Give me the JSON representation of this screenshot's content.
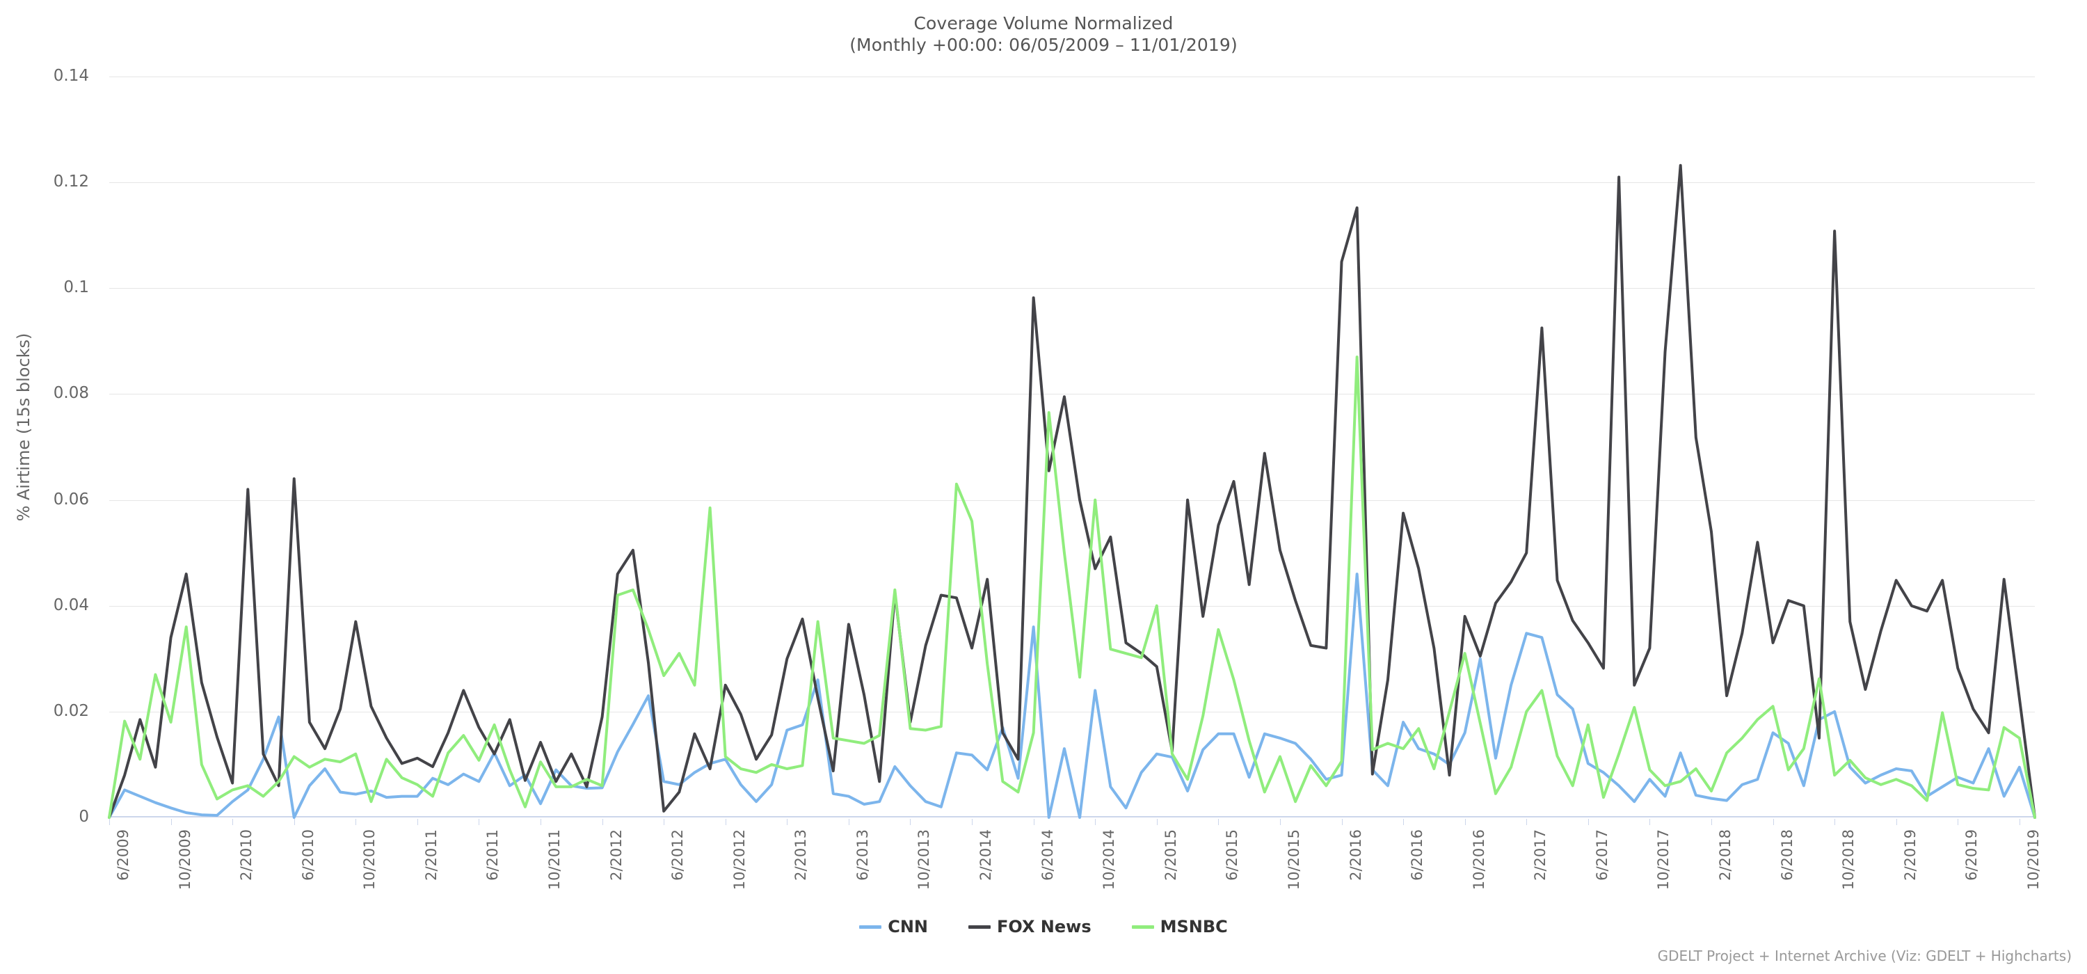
{
  "chart_data": {
    "type": "line",
    "title": "Coverage Volume Normalized",
    "subtitle": "(Monthly +00:00: 06/05/2009 – 11/01/2019)",
    "xlabel": "",
    "ylabel": "% Airtime (15s blocks)",
    "ylim": [
      0,
      0.14
    ],
    "y_ticks": [
      "0",
      "0.02",
      "0.04",
      "0.06",
      "0.08",
      "0.1",
      "0.12",
      "0.14"
    ],
    "y_tick_values": [
      0,
      0.02,
      0.04,
      0.06,
      0.08,
      0.1,
      0.12,
      0.14
    ],
    "grid": true,
    "legend_position": "bottom",
    "credit": "GDELT Project + Internet Archive (Viz: GDELT + Highcharts)",
    "x_tick_labels": [
      "6/2009",
      "10/2009",
      "2/2010",
      "6/2010",
      "10/2010",
      "2/2011",
      "6/2011",
      "10/2011",
      "2/2012",
      "6/2012",
      "10/2012",
      "2/2013",
      "6/2013",
      "10/2013",
      "2/2014",
      "6/2014",
      "10/2014",
      "2/2015",
      "6/2015",
      "10/2015",
      "2/2016",
      "6/2016",
      "10/2016",
      "2/2017",
      "6/2017",
      "10/2017",
      "2/2018",
      "6/2018",
      "10/2018",
      "2/2019",
      "6/2019",
      "10/2019"
    ],
    "x_tick_interval_months": 4,
    "x_start": "6/2009",
    "x_end": "11/2019",
    "categories": [
      "6/2009",
      "7/2009",
      "8/2009",
      "9/2009",
      "10/2009",
      "11/2009",
      "12/2009",
      "1/2010",
      "2/2010",
      "3/2010",
      "4/2010",
      "5/2010",
      "6/2010",
      "7/2010",
      "8/2010",
      "9/2010",
      "10/2010",
      "11/2010",
      "12/2010",
      "1/2011",
      "2/2011",
      "3/2011",
      "4/2011",
      "5/2011",
      "6/2011",
      "7/2011",
      "8/2011",
      "9/2011",
      "10/2011",
      "11/2011",
      "12/2011",
      "1/2012",
      "2/2012",
      "3/2012",
      "4/2012",
      "5/2012",
      "6/2012",
      "7/2012",
      "8/2012",
      "9/2012",
      "10/2012",
      "11/2012",
      "12/2012",
      "1/2013",
      "2/2013",
      "3/2013",
      "4/2013",
      "5/2013",
      "6/2013",
      "7/2013",
      "8/2013",
      "9/2013",
      "10/2013",
      "11/2013",
      "12/2013",
      "1/2014",
      "2/2014",
      "3/2014",
      "4/2014",
      "5/2014",
      "6/2014",
      "7/2014",
      "8/2014",
      "9/2014",
      "10/2014",
      "11/2014",
      "12/2014",
      "1/2015",
      "2/2015",
      "3/2015",
      "4/2015",
      "5/2015",
      "6/2015",
      "7/2015",
      "8/2015",
      "9/2015",
      "10/2015",
      "11/2015",
      "12/2015",
      "1/2016",
      "2/2016",
      "3/2016",
      "4/2016",
      "5/2016",
      "6/2016",
      "7/2016",
      "8/2016",
      "9/2016",
      "10/2016",
      "11/2016",
      "12/2016",
      "1/2017",
      "2/2017",
      "3/2017",
      "4/2017",
      "5/2017",
      "6/2017",
      "7/2017",
      "8/2017",
      "9/2017",
      "10/2017",
      "11/2017",
      "12/2017",
      "1/2018",
      "2/2018",
      "3/2018",
      "4/2018",
      "5/2018",
      "6/2018",
      "7/2018",
      "8/2018",
      "9/2018",
      "10/2018",
      "11/2018",
      "12/2018",
      "1/2019",
      "2/2019",
      "3/2019",
      "4/2019",
      "5/2019",
      "6/2019",
      "7/2019",
      "8/2019",
      "9/2019",
      "10/2019",
      "11/2019"
    ],
    "series": [
      {
        "name": "CNN",
        "color": "#7cb5ec",
        "values": [
          0.0,
          0.0052,
          0.004,
          0.0028,
          0.0018,
          0.0009,
          0.0005,
          0.0004,
          0.003,
          0.0052,
          0.011,
          0.019,
          0.0,
          0.006,
          0.0092,
          0.0048,
          0.0044,
          0.005,
          0.0038,
          0.004,
          0.004,
          0.0074,
          0.0062,
          0.0082,
          0.0068,
          0.0122,
          0.006,
          0.008,
          0.0026,
          0.009,
          0.006,
          0.0055,
          0.0056,
          0.0124,
          0.0176,
          0.023,
          0.0068,
          0.0062,
          0.0085,
          0.0102,
          0.011,
          0.0062,
          0.003,
          0.0062,
          0.0165,
          0.0175,
          0.026,
          0.0045,
          0.004,
          0.0025,
          0.003,
          0.0096,
          0.006,
          0.003,
          0.002,
          0.0122,
          0.0118,
          0.009,
          0.017,
          0.0074,
          0.036,
          0.0,
          0.013,
          0.0,
          0.024,
          0.0058,
          0.0018,
          0.0085,
          0.012,
          0.0114,
          0.005,
          0.0128,
          0.0158,
          0.0158,
          0.0076,
          0.0158,
          0.015,
          0.014,
          0.011,
          0.0072,
          0.008,
          0.046,
          0.009,
          0.006,
          0.018,
          0.013,
          0.012,
          0.01,
          0.016,
          0.03,
          0.0112,
          0.025,
          0.0348,
          0.034,
          0.0232,
          0.0205,
          0.0102,
          0.0085,
          0.006,
          0.003,
          0.0072,
          0.004,
          0.0122,
          0.0042,
          0.0036,
          0.0032,
          0.0062,
          0.0072,
          0.016,
          0.014,
          0.006,
          0.0185,
          0.02,
          0.0095,
          0.0065,
          0.008,
          0.0092,
          0.0088,
          0.004,
          0.0058,
          0.0076,
          0.0065,
          0.013,
          0.004,
          0.0095,
          0.0
        ]
      },
      {
        "name": "FOX News",
        "color": "#434348",
        "values": [
          0.0,
          0.008,
          0.0185,
          0.0095,
          0.034,
          0.046,
          0.0255,
          0.0152,
          0.0065,
          0.062,
          0.012,
          0.006,
          0.064,
          0.018,
          0.013,
          0.0205,
          0.037,
          0.021,
          0.015,
          0.0102,
          0.0112,
          0.0096,
          0.016,
          0.024,
          0.017,
          0.012,
          0.0185,
          0.007,
          0.0142,
          0.0068,
          0.012,
          0.0058,
          0.019,
          0.046,
          0.0505,
          0.0292,
          0.0012,
          0.0048,
          0.0158,
          0.0092,
          0.025,
          0.0195,
          0.011,
          0.0156,
          0.03,
          0.0375,
          0.0226,
          0.0088,
          0.0365,
          0.0232,
          0.0068,
          0.0425,
          0.018,
          0.0325,
          0.042,
          0.0415,
          0.032,
          0.045,
          0.016,
          0.011,
          0.0982,
          0.0655,
          0.0795,
          0.06,
          0.047,
          0.053,
          0.033,
          0.031,
          0.0285,
          0.0125,
          0.06,
          0.038,
          0.0552,
          0.0635,
          0.044,
          0.0688,
          0.0505,
          0.041,
          0.0325,
          0.032,
          0.105,
          0.1152,
          0.0082,
          0.026,
          0.0575,
          0.047,
          0.032,
          0.008,
          0.038,
          0.0305,
          0.0405,
          0.0445,
          0.05,
          0.0925,
          0.0448,
          0.0372,
          0.033,
          0.0282,
          0.121,
          0.025,
          0.032,
          0.088,
          0.1232,
          0.0718,
          0.054,
          0.023,
          0.0348,
          0.052,
          0.033,
          0.041,
          0.04,
          0.015,
          0.1108,
          0.037,
          0.0242,
          0.0352,
          0.0448,
          0.04,
          0.039,
          0.0448,
          0.0282,
          0.0205,
          0.016,
          0.045,
          0.0225,
          0.0
        ]
      },
      {
        "name": "MSNBC",
        "color": "#90ed7d",
        "values": [
          0.0,
          0.0182,
          0.011,
          0.027,
          0.018,
          0.036,
          0.01,
          0.0035,
          0.0052,
          0.006,
          0.004,
          0.0068,
          0.0115,
          0.0095,
          0.011,
          0.0105,
          0.012,
          0.003,
          0.011,
          0.0075,
          0.0062,
          0.004,
          0.0122,
          0.0155,
          0.0108,
          0.0175,
          0.009,
          0.002,
          0.0105,
          0.0058,
          0.0058,
          0.0072,
          0.006,
          0.042,
          0.043,
          0.0355,
          0.0268,
          0.031,
          0.025,
          0.0585,
          0.0115,
          0.0092,
          0.0085,
          0.01,
          0.0092,
          0.0098,
          0.037,
          0.015,
          0.0145,
          0.014,
          0.0155,
          0.043,
          0.0168,
          0.0165,
          0.0172,
          0.063,
          0.056,
          0.029,
          0.0068,
          0.0048,
          0.016,
          0.0765,
          0.05,
          0.0265,
          0.06,
          0.0318,
          0.031,
          0.0302,
          0.04,
          0.012,
          0.0072,
          0.0192,
          0.0355,
          0.026,
          0.0145,
          0.0048,
          0.0115,
          0.003,
          0.0098,
          0.006,
          0.0106,
          0.087,
          0.0128,
          0.014,
          0.013,
          0.0168,
          0.0092,
          0.02,
          0.031,
          0.0178,
          0.0045,
          0.0095,
          0.02,
          0.024,
          0.0116,
          0.006,
          0.0175,
          0.0038,
          0.012,
          0.0208,
          0.009,
          0.006,
          0.0068,
          0.0092,
          0.005,
          0.0122,
          0.015,
          0.0185,
          0.021,
          0.009,
          0.013,
          0.0262,
          0.008,
          0.0108,
          0.0075,
          0.0062,
          0.0072,
          0.006,
          0.0032,
          0.0198,
          0.0062,
          0.0055,
          0.0052,
          0.017,
          0.015,
          0.0
        ]
      }
    ]
  },
  "legend": {
    "items": [
      {
        "label": "CNN"
      },
      {
        "label": "FOX News"
      },
      {
        "label": "MSNBC"
      }
    ]
  }
}
